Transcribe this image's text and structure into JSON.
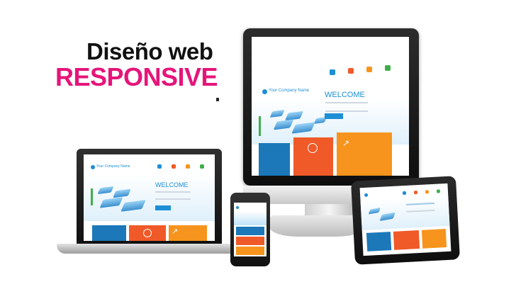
{
  "headline": {
    "line1": "Diseño web",
    "line2": "RESPONSIVE"
  },
  "site": {
    "company_name": "Your Company Name",
    "welcome": "WELCOME",
    "tile_colors": [
      "#1c78b9",
      "#f05a28",
      "#f7941d"
    ]
  },
  "colors": {
    "brand_blue": "#1c8fd6",
    "headline_pink": "#e5157a",
    "tile_blue": "#1c78b9",
    "tile_red": "#f05a28",
    "tile_orange": "#f7941d",
    "accent_green": "#3fae49"
  },
  "devices": [
    "desktop-monitor",
    "laptop",
    "smartphone",
    "tablet"
  ]
}
